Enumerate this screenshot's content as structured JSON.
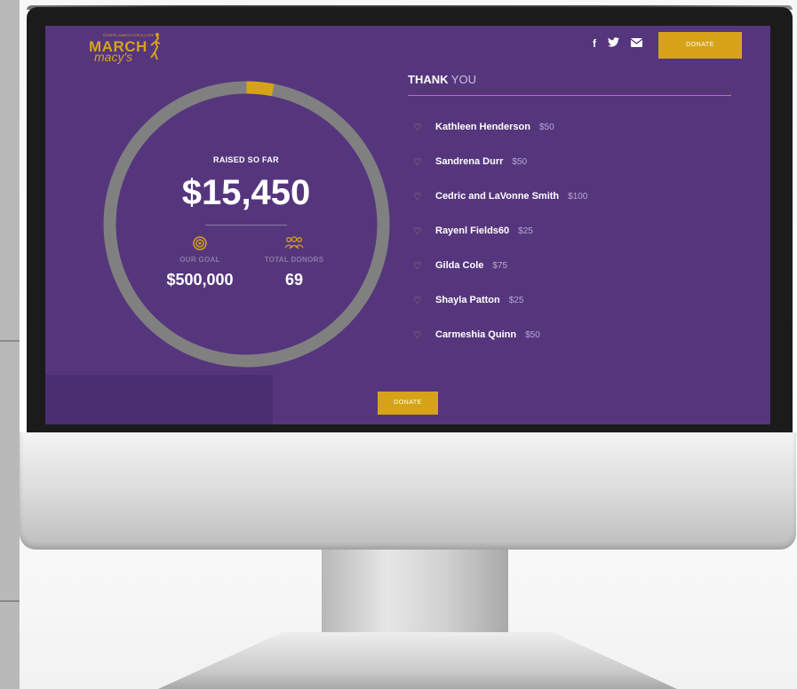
{
  "header": {
    "logo_text_top": "MARCH",
    "logo_text_bottom": "macy's",
    "logo_tagline": "GOSPEL MARCH FOR A CURE",
    "social_icons": [
      "facebook-icon",
      "twitter-icon",
      "mail-icon"
    ],
    "donate_label": "DONATE"
  },
  "progress": {
    "raised_label": "RAISED SO FAR",
    "raised_amount": "$15,450",
    "fraction_of_goal": 0.0309,
    "ring_track_color": "#808080",
    "ring_fill_color": "#d6a318"
  },
  "stats": {
    "goal_label": "OUR GOAL",
    "goal_value": "$500,000",
    "goal_icon": "target-icon",
    "donors_label": "TOTAL DONORS",
    "donors_value": "69",
    "donors_icon": "people-icon"
  },
  "thanks": {
    "title_bold": "THANK",
    "title_light": "YOU",
    "donors": [
      {
        "name": "Kathleen Henderson",
        "amount": "$50"
      },
      {
        "name": "Sandrena Durr",
        "amount": "$50"
      },
      {
        "name": "Cedric and LaVonne Smith",
        "amount": "$100"
      },
      {
        "name": "Rayenl Fields60",
        "amount": "$25"
      },
      {
        "name": "Gilda Cole",
        "amount": "$75"
      },
      {
        "name": "Shayla Patton",
        "amount": "$25"
      },
      {
        "name": "Carmeshia Quinn",
        "amount": "$50"
      }
    ]
  },
  "footer": {
    "donate_label": "DONATE"
  },
  "colors": {
    "screen_bg": "#55367d",
    "accent_gold": "#d6a318"
  }
}
